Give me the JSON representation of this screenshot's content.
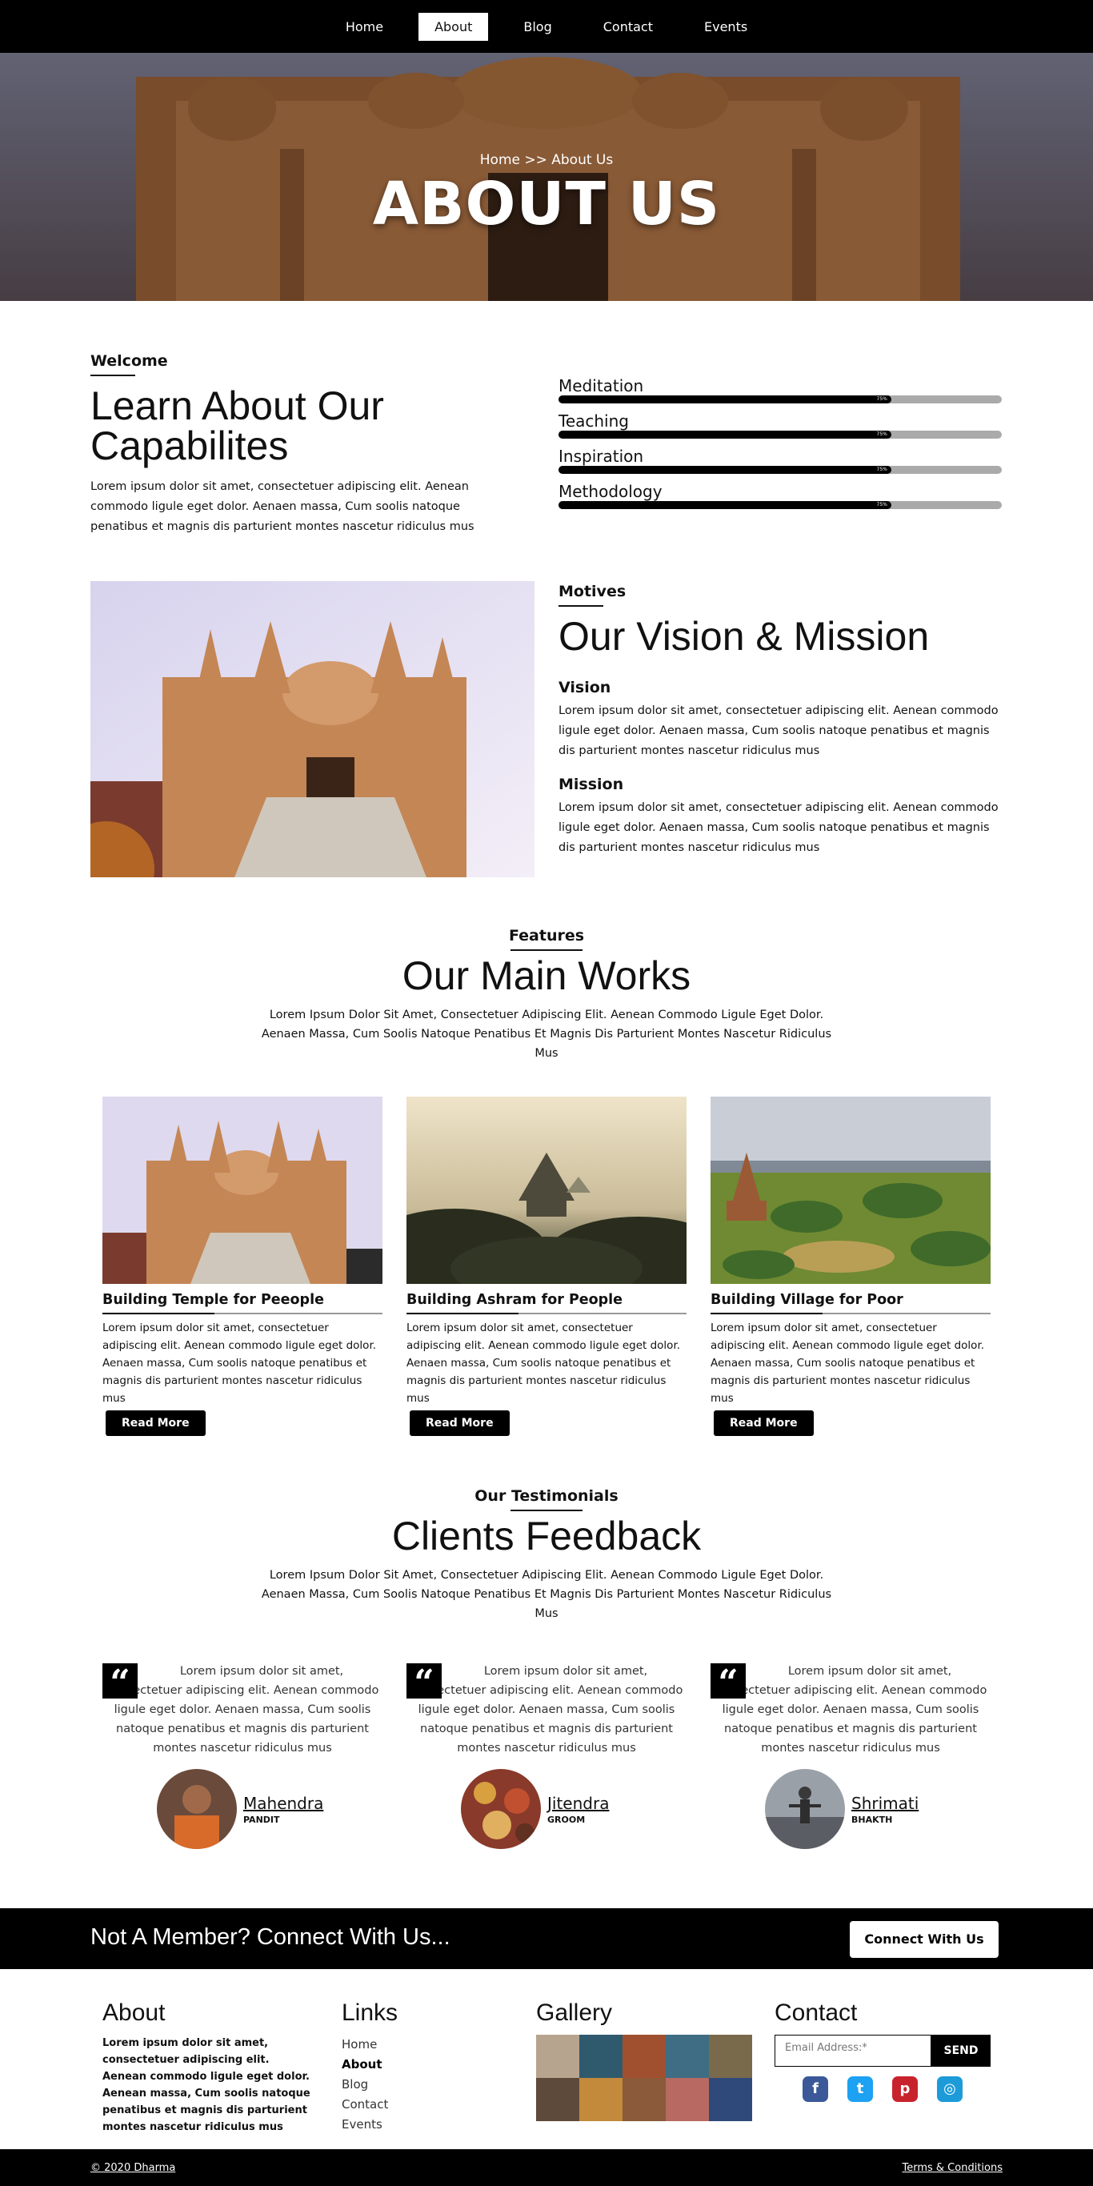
{
  "nav": {
    "items": [
      {
        "label": "Home"
      },
      {
        "label": "About"
      },
      {
        "label": "Blog"
      },
      {
        "label": "Contact"
      },
      {
        "label": "Events"
      }
    ],
    "active": "About"
  },
  "hero": {
    "breadcrumb": "Home >> About Us",
    "title": "ABOUT US"
  },
  "welcome": {
    "kicker": "Welcome",
    "title_line1": "Learn About Our",
    "title_line2": "Capabilites",
    "text": "Lorem ipsum dolor sit amet, consectetuer adipiscing elit. Aenean commodo ligule eget dolor. Aenaen massa, Cum soolis natoque penatibus et magnis dis parturient montes nascetur ridiculus mus"
  },
  "skills": [
    {
      "label": "Meditation",
      "percent": 75,
      "pct_label": "75%"
    },
    {
      "label": "Teaching",
      "percent": 75,
      "pct_label": "75%"
    },
    {
      "label": "Inspiration",
      "percent": 75,
      "pct_label": "75%"
    },
    {
      "label": "Methodology",
      "percent": 75,
      "pct_label": "75%"
    }
  ],
  "motives": {
    "kicker": "Motives",
    "title": "Our Vision & Mission",
    "vision_title": "Vision",
    "vision_text": "Lorem ipsum dolor sit amet, consectetuer adipiscing elit. Aenean commodo ligule eget dolor. Aenaen massa, Cum soolis natoque penatibus et magnis dis parturient montes nascetur ridiculus mus",
    "mission_title": "Mission",
    "mission_text": "Lorem ipsum dolor sit amet, consectetuer adipiscing elit. Aenean commodo ligule eget dolor. Aenaen massa, Cum soolis natoque penatibus et magnis dis parturient montes nascetur ridiculus mus"
  },
  "features": {
    "kicker": "Features",
    "title": "Our Main Works",
    "lead": "Lorem Ipsum Dolor Sit Amet, Consectetuer Adipiscing Elit. Aenean Commodo Ligule Eget Dolor. Aenaen Massa, Cum Soolis Natoque Penatibus Et Magnis Dis Parturient Montes Nascetur Ridiculus Mus",
    "cards": [
      {
        "title": "Building Temple for Peeople",
        "text": "Lorem ipsum dolor sit amet, consectetuer adipiscing elit. Aenean commodo ligule eget dolor. Aenaen massa, Cum soolis natoque penatibus et magnis dis parturient montes nascetur ridiculus mus",
        "button": "Read More"
      },
      {
        "title": "Building Ashram for People",
        "text": "Lorem ipsum dolor sit amet, consectetuer adipiscing elit. Aenean commodo ligule eget dolor. Aenaen massa, Cum soolis natoque penatibus et magnis dis parturient montes nascetur ridiculus mus",
        "button": "Read More"
      },
      {
        "title": "Building Village for Poor",
        "text": "Lorem ipsum dolor sit amet, consectetuer adipiscing elit. Aenean commodo ligule eget dolor. Aenaen massa, Cum soolis natoque penatibus et magnis dis parturient montes nascetur ridiculus mus",
        "button": "Read More"
      }
    ]
  },
  "testimonials": {
    "kicker": "Our Testimonials",
    "title": "Clients Feedback",
    "lead": "Lorem Ipsum Dolor Sit Amet, Consectetuer Adipiscing Elit. Aenean Commodo Ligule Eget Dolor. Aenaen Massa, Cum Soolis Natoque Penatibus Et Magnis Dis Parturient Montes Nascetur Ridiculus Mus",
    "items": [
      {
        "text": "Lorem ipsum dolor sit amet, consectetuer adipiscing elit. Aenean commodo ligule eget dolor. Aenaen massa, Cum soolis natoque penatibus et magnis dis parturient montes nascetur ridiculus mus",
        "name": "Mahendra",
        "role": "PANDIT"
      },
      {
        "text": "Lorem ipsum dolor sit amet, consectetuer adipiscing elit. Aenean commodo ligule eget dolor. Aenaen massa, Cum soolis natoque penatibus et magnis dis parturient montes nascetur ridiculus mus",
        "name": "Jitendra",
        "role": "GROOM"
      },
      {
        "text": "Lorem ipsum dolor sit amet, consectetuer adipiscing elit. Aenean commodo ligule eget dolor. Aenaen massa, Cum soolis natoque penatibus et magnis dis parturient montes nascetur ridiculus mus",
        "name": "Shrimati",
        "role": "BHAKTH"
      }
    ],
    "quote_glyph": "“"
  },
  "cta": {
    "message": "Not A Member? Connect With Us...",
    "button": "Connect With Us"
  },
  "footer": {
    "about_title": "About",
    "about_text": "Lorem ipsum dolor sit amet, consectetuer adipiscing elit. Aenean commodo ligule eget dolor. Aenean massa, Cum soolis natoque penatibus et magnis dis parturient montes nascetur ridiculus mus",
    "links_title": "Links",
    "links": [
      "Home",
      "About",
      "Blog",
      "Contact",
      "Events"
    ],
    "gallery_title": "Gallery",
    "contact_title": "Contact",
    "email_placeholder": "Email Address:*",
    "send_label": "SEND",
    "socials": [
      {
        "icon": "facebook-icon",
        "glyph": "f",
        "color": "#3b5998"
      },
      {
        "icon": "twitter-icon",
        "glyph": "t",
        "color": "#1da1f2"
      },
      {
        "icon": "pinterest-icon",
        "glyph": "p",
        "color": "#c8232c"
      },
      {
        "icon": "instagram-icon",
        "glyph": "◎",
        "color": "#1c9bd8"
      }
    ],
    "copyright": "© 2020 Dharma",
    "terms": "Terms & Conditions"
  }
}
